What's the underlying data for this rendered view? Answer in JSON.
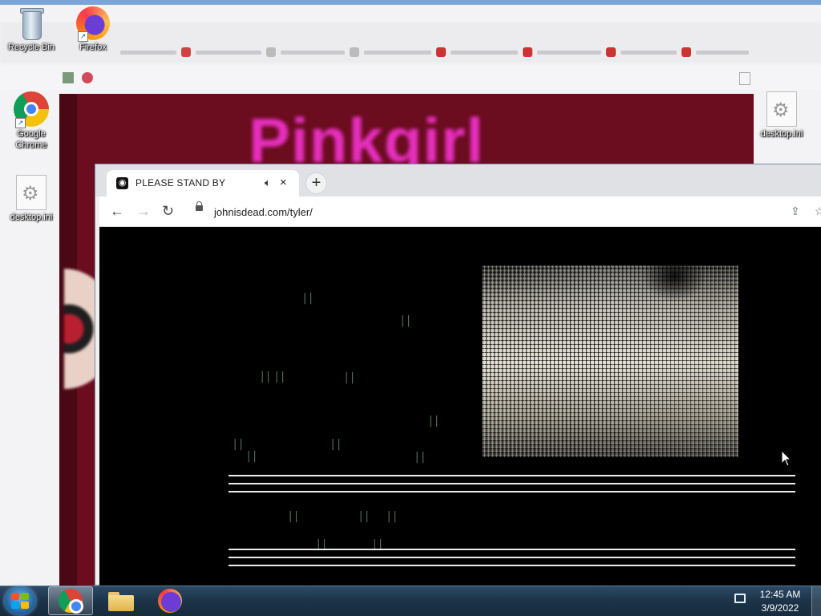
{
  "desktop": {
    "icons": [
      {
        "label": "Recycle Bin",
        "icon": "recycle-bin-icon"
      },
      {
        "label": "Firefox",
        "icon": "firefox-icon"
      },
      {
        "label": "Google Chrome",
        "icon": "chrome-icon"
      },
      {
        "label": "desktop.ini",
        "icon": "settings-file-icon"
      },
      {
        "label": "desktop.ini",
        "icon": "settings-file-icon"
      }
    ]
  },
  "background_window": {
    "page_heading": "Pinkgirl",
    "page_color": "#6b0c1f",
    "heading_color": "#e62fbe"
  },
  "browser": {
    "tab": {
      "title": "PLEASE STAND BY",
      "favicon": "eye-icon",
      "audio": "speaker-icon",
      "close": "×"
    },
    "new_tab": "+",
    "nav": {
      "back": "←",
      "forward": "→",
      "reload": "↻"
    },
    "url": "johnisdead.com/tyler/",
    "share": "share-icon",
    "star": "star-icon"
  },
  "content": {
    "glyph": "||",
    "background": "#000000",
    "static_panel": "tv-static"
  },
  "taskbar": {
    "start": "windows-start-icon",
    "apps": [
      {
        "name": "chrome-icon",
        "active": true
      },
      {
        "name": "file-explorer-icon",
        "active": false
      },
      {
        "name": "firefox-icon",
        "active": false
      }
    ],
    "clock": {
      "time": "12:45 AM",
      "date": "3/9/2022"
    }
  }
}
